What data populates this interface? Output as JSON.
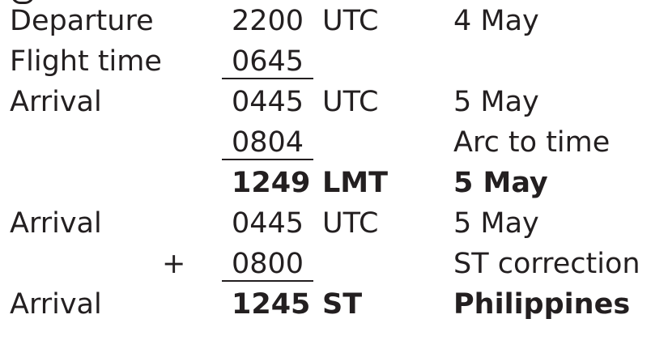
{
  "rows": [
    {
      "label": "Departure",
      "sign": "",
      "time": "2200",
      "zone": "UTC",
      "note": "4 May"
    },
    {
      "label": "Flight time",
      "sign": "",
      "time": "0645",
      "zone": "",
      "note": ""
    },
    {
      "label": "Arrival",
      "sign": "",
      "time": "0445",
      "zone": "UTC",
      "note": "5 May"
    },
    {
      "label": "",
      "sign": "",
      "time": "0804",
      "zone": "",
      "note": "Arc to time"
    },
    {
      "label": "",
      "sign": "",
      "time": "1249",
      "zone": "LMT",
      "note": "5 May"
    },
    {
      "label": "Arrival",
      "sign": "",
      "time": "0445",
      "zone": "UTC",
      "note": "5 May"
    },
    {
      "label": "",
      "sign": "+",
      "time": "0800",
      "zone": "",
      "note": "ST correction"
    },
    {
      "label": "Arrival",
      "sign": "",
      "time": "1245",
      "zone": "ST",
      "note": "Philippines"
    }
  ]
}
